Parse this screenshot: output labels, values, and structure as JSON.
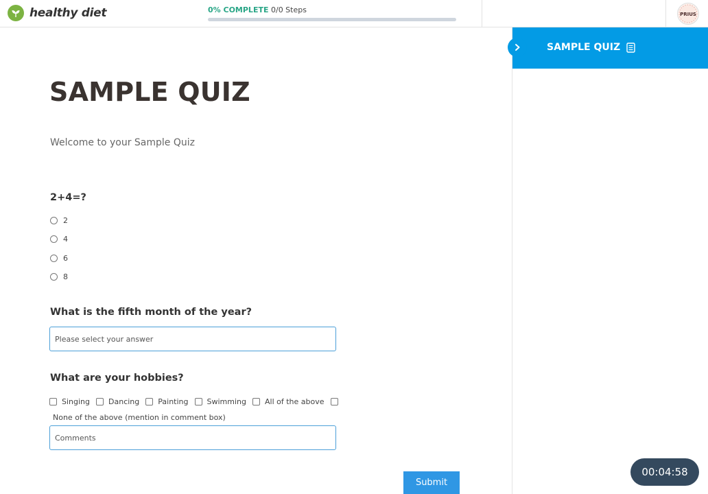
{
  "header": {
    "brand_name": "healthy diet",
    "progress_percent_label": "0% COMPLETE",
    "progress_steps_label": "0/0 Steps",
    "progress_fraction": 0,
    "avatar_text": "PRIUS"
  },
  "quiz": {
    "title": "SAMPLE QUIZ",
    "welcome": "Welcome to your Sample Quiz",
    "q1": {
      "question": "2+4=?",
      "options": [
        "2",
        "4",
        "6",
        "8"
      ]
    },
    "q2": {
      "question": "What is the fifth month of the year?",
      "placeholder": "Please select your answer"
    },
    "q3": {
      "question": "What are your hobbies?",
      "options": [
        "Singing",
        "Dancing",
        "Painting",
        "Swimming",
        "All of the above",
        "None of the above (mention in comment box)"
      ],
      "comment_placeholder": "Comments"
    },
    "submit_label": "Submit"
  },
  "sidebar": {
    "title": "SAMPLE QUIZ",
    "icon": "document-icon"
  },
  "timer": {
    "value": "00:04:58"
  },
  "colors": {
    "accent_blue": "#039be5",
    "progress_green": "#2aa687",
    "submit_blue": "#2f97e4",
    "timer_bg": "#34495e",
    "brand_green": "#7cb342"
  }
}
